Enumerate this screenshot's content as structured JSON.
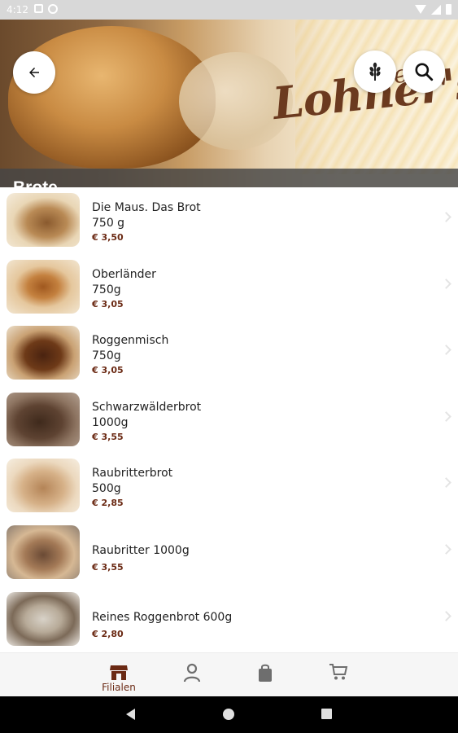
{
  "status_bar": {
    "time": "4:12"
  },
  "header": {
    "page_title": "Brote",
    "logo_text": "Lohner's",
    "logo_prefix": "Die"
  },
  "products": [
    {
      "name": "Die Maus. Das Brot",
      "weight": "750 g",
      "price": "€ 3,50"
    },
    {
      "name": "Oberländer",
      "weight": "750g",
      "price": "€ 3,05"
    },
    {
      "name": "Roggenmisch",
      "weight": "750g",
      "price": "€ 3,05"
    },
    {
      "name": "Schwarzwälderbrot",
      "weight": "1000g",
      "price": "€ 3,55"
    },
    {
      "name": "Raubritterbrot",
      "weight": "500g",
      "price": "€ 2,85"
    },
    {
      "name": "Raubritter 1000g",
      "weight": "",
      "price": "€ 3,55"
    },
    {
      "name": "Reines Roggenbrot 600g",
      "weight": "",
      "price": "€ 2,80"
    }
  ],
  "bottom_nav": {
    "filialen_label": "Filialen",
    "items": [
      "store-icon",
      "person-icon",
      "bag-icon",
      "cart-icon"
    ]
  },
  "colors": {
    "accent": "#6b2a14",
    "title_bar": "#464646"
  }
}
